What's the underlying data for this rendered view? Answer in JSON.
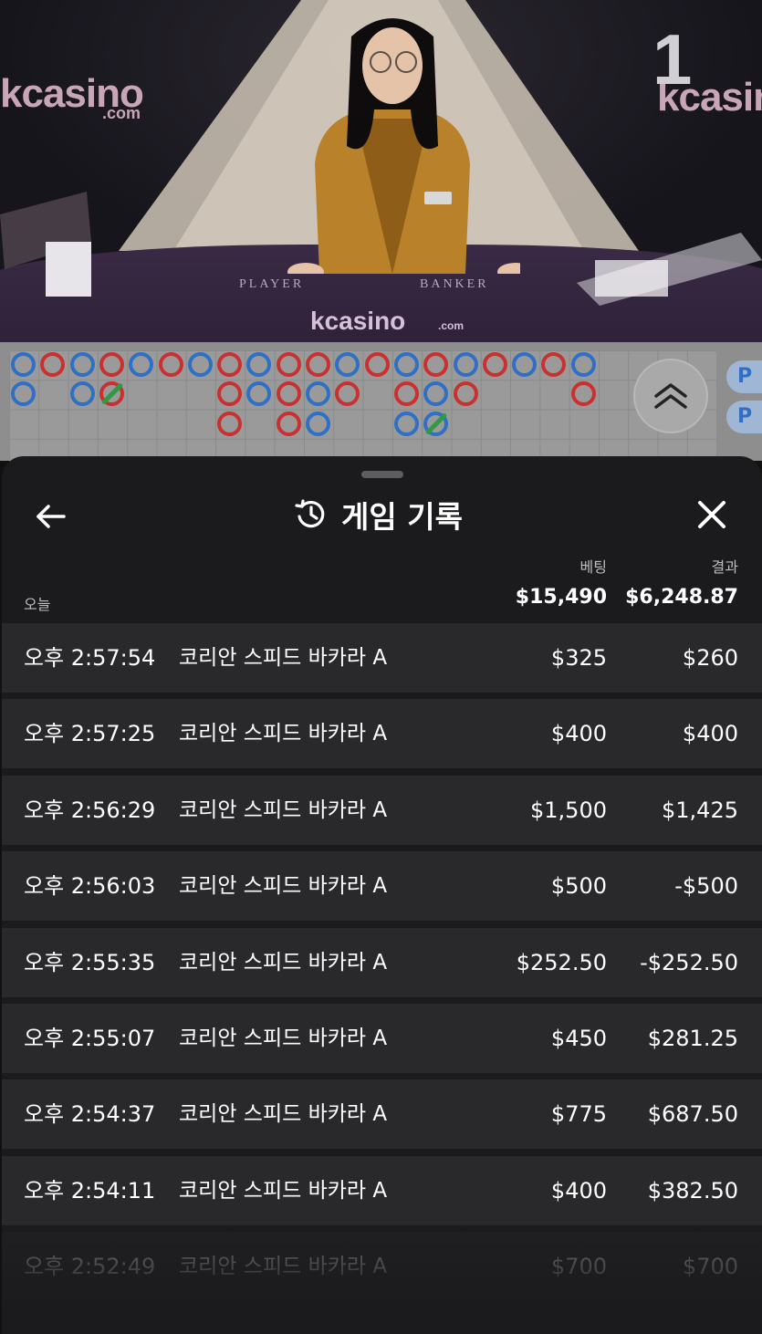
{
  "video": {
    "round_number": "1",
    "brand_left": "kcasino",
    "brand_left_sub": ".com",
    "brand_right": "kcasino",
    "table_brand": "kcasino",
    "table_brand_sub": ".com",
    "table_label_player": "PLAYER",
    "table_label_banker": "BANKER"
  },
  "roadmap": {
    "side_chips": [
      "P",
      "P"
    ],
    "colors": {
      "player": "#2f6fc4",
      "banker": "#c8312f",
      "tie": "#2e9b44"
    }
  },
  "sheet": {
    "title": "게임 기록",
    "title_icon": "history-icon",
    "back_icon": "arrow-left-icon",
    "close_icon": "close-icon",
    "column_bet": "베팅",
    "column_result": "결과",
    "today_label": "오늘",
    "total_bet": "$15,490",
    "total_result": "$6,248.87",
    "rows": [
      {
        "time": "오후 2:57:54",
        "game": "코리안 스피드 바카라 A",
        "bet": "$325",
        "result": "$260"
      },
      {
        "time": "오후 2:57:25",
        "game": "코리안 스피드 바카라 A",
        "bet": "$400",
        "result": "$400"
      },
      {
        "time": "오후 2:56:29",
        "game": "코리안 스피드 바카라 A",
        "bet": "$1,500",
        "result": "$1,425"
      },
      {
        "time": "오후 2:56:03",
        "game": "코리안 스피드 바카라 A",
        "bet": "$500",
        "result": "-$500"
      },
      {
        "time": "오후 2:55:35",
        "game": "코리안 스피드 바카라 A",
        "bet": "$252.50",
        "result": "-$252.50"
      },
      {
        "time": "오후 2:55:07",
        "game": "코리안 스피드 바카라 A",
        "bet": "$450",
        "result": "$281.25"
      },
      {
        "time": "오후 2:54:37",
        "game": "코리안 스피드 바카라 A",
        "bet": "$775",
        "result": "$687.50"
      },
      {
        "time": "오후 2:54:11",
        "game": "코리안 스피드 바카라 A",
        "bet": "$400",
        "result": "$382.50"
      },
      {
        "time": "오후 2:52:49",
        "game": "코리안 스피드 바카라 A",
        "bet": "$700",
        "result": "$700"
      }
    ]
  }
}
